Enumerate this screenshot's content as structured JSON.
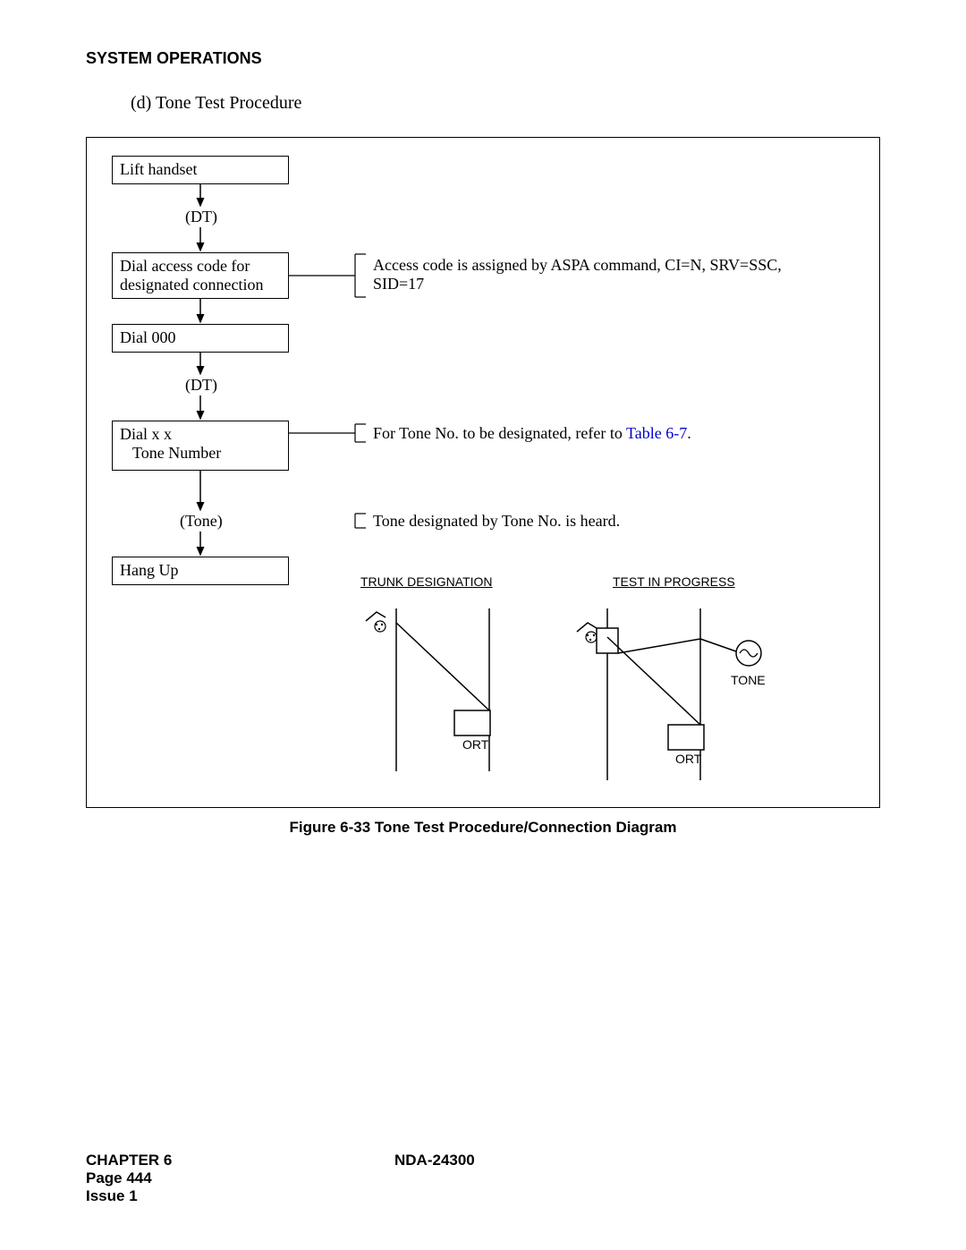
{
  "header": "SYSTEM OPERATIONS",
  "subheader": "(d)   Tone Test Procedure",
  "flow": {
    "step1": "Lift handset",
    "dt1": "(DT)",
    "step2": "Dial access code for designated connection",
    "note2a": "Access code is assigned by ASPA command, CI=N, SRV=SSC,",
    "note2b": "SID=17",
    "step3": "Dial   000",
    "dt2": "(DT)",
    "step4a": "Dial     x x",
    "step4b": "Tone Number",
    "note4_prefix": "For Tone No. to be designated, refer to ",
    "note4_link": "Table 6-7",
    "note4_suffix": ".",
    "tone_label": "(Tone)",
    "note_tone": "Tone designated by Tone No. is heard.",
    "step5": "Hang Up",
    "trunk_label": "TRUNK DESIGNATION",
    "test_label": "TEST IN PROGRESS",
    "ort1": "ORT",
    "ort2": "ORT",
    "tone_small": "TONE"
  },
  "caption": "Figure 6-33  Tone Test Procedure/Connection Diagram",
  "footer": {
    "chapter": "CHAPTER 6",
    "page": "Page 444",
    "issue": "Issue 1",
    "docnum": "NDA-24300"
  }
}
